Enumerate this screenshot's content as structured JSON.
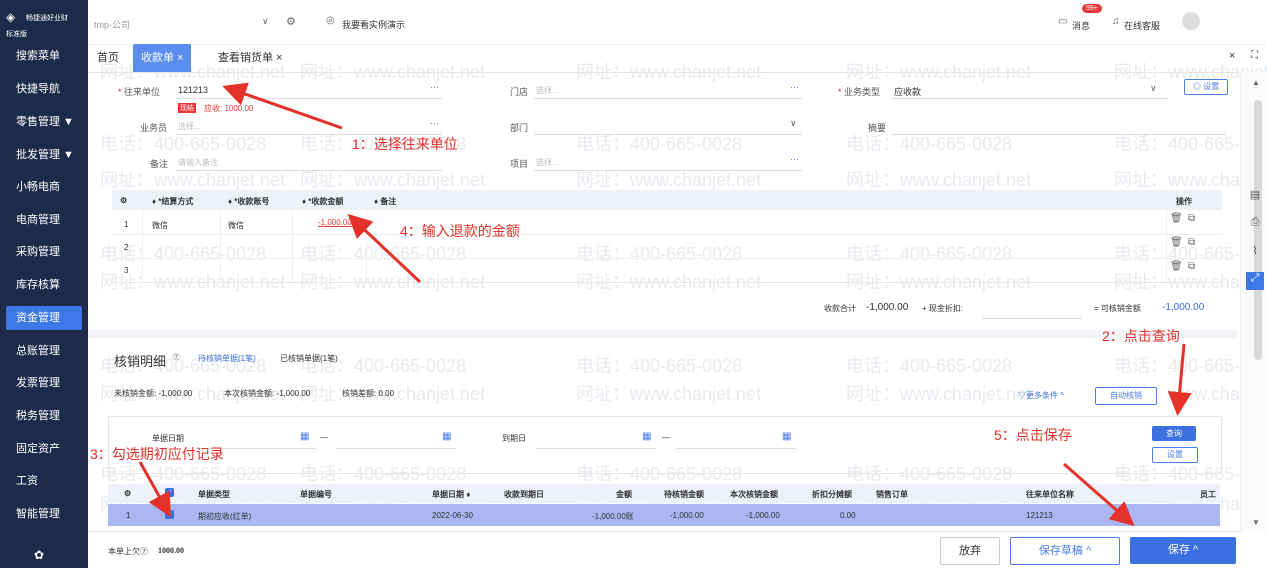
{
  "brand": {
    "name": "畅捷通好业财",
    "edition": "标准版"
  },
  "sidebar": {
    "items": [
      "搜索菜单",
      "快捷导航",
      "零售管理 ▼",
      "批发管理 ▼",
      "小畅电商",
      "电商管理",
      "采购管理",
      "库存核算",
      "资金管理",
      "总账管理",
      "发票管理",
      "税务管理",
      "固定资产",
      "工资",
      "智能管理"
    ],
    "active": "资金管理"
  },
  "topbar": {
    "org": "tmp-公司",
    "demo": "我要看实例演示",
    "msg": "消息",
    "badge": "99+",
    "service": "在线客服"
  },
  "tabs": [
    {
      "label": "首页"
    },
    {
      "label": "收款单 ×"
    },
    {
      "label": "查看销货单 ×"
    }
  ],
  "form": {
    "partner_label": "往来单位",
    "partner_value": "121213",
    "tag_now": "现结",
    "receivable": "应收: 1000.00",
    "store_label": "门店",
    "store_ph": "选择...",
    "biztype_label": "业务类型",
    "biztype_value": "应收款",
    "settings_btn": "◎ 设置",
    "salesman_label": "业务员",
    "salesman_ph": "选择...",
    "dept_label": "部门",
    "summary_label": "摘要",
    "note_label": "备注",
    "note_ph": "请输入备注",
    "project_label": "项目",
    "project_ph": "选择..."
  },
  "pay_table": {
    "headers": [
      "⚙",
      "♦ *结算方式",
      "♦ *收款账号",
      "♦ *收款金额",
      "♦ 备注",
      "操作"
    ],
    "rows": [
      {
        "no": "1",
        "method": "微信",
        "account": "微信",
        "amount": "-1,000.00"
      },
      {
        "no": "2",
        "method": "",
        "account": "",
        "amount": ""
      },
      {
        "no": "3",
        "method": "",
        "account": "",
        "amount": ""
      }
    ],
    "total_label": "收款合计",
    "total_value": "-1,000.00",
    "discount_label": "+  现金折扣:",
    "verify_label": "=  可核销金额",
    "verify_value": "-1,000.00"
  },
  "verify": {
    "title": "核销明细",
    "tab_pending": "待核销单据(1笔)",
    "tab_done": "已核销单据(1笔)",
    "unverified": "未核销金额: -1,000.00",
    "this_verify": "本次核销金额: -1,000.00",
    "diff": "核销差额: 0.00",
    "more": "▽更多条件 ^",
    "auto": "自动核销",
    "date_label": "单据日期",
    "due_label": "到期日",
    "dash": "—",
    "query": "查询",
    "setting": "设置",
    "headers": [
      "单据类型",
      "单据编号",
      "单据日期 ♦",
      "收款到期日",
      "金额",
      "待核销金额",
      "本次核销金额",
      "折扣分摊额",
      "销售订单",
      "往来单位名称",
      "员工"
    ],
    "row": {
      "no": "1",
      "type": "期初应收(红单)",
      "number": "",
      "date": "2022-06-30",
      "due": "",
      "amount": "-1,000.00账",
      "pending": "-1,000.00",
      "this": "-1,000.00",
      "discount": "0.00",
      "order": "",
      "partner": "121213"
    }
  },
  "footer": {
    "owed_label": "本单上欠⑦",
    "owed_value": "1000.00",
    "discard": "放弃",
    "draft": "保存草稿 ^",
    "save": "保存 ^"
  },
  "annotations": {
    "a1": "1：选择往来单位",
    "a2": "2：点击查询",
    "a3": "3：勾选期初应付记录",
    "a4": "4：输入退款的金额",
    "a5": "5：点击保存"
  },
  "watermark": {
    "phone": "电话：400-665-0028",
    "site": "网址：www.chanjet.net"
  }
}
